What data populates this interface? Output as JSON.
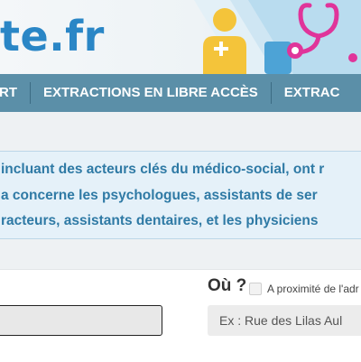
{
  "header": {
    "logo_text": "te.fr"
  },
  "nav": {
    "items": [
      {
        "label": "RT"
      },
      {
        "label": "EXTRACTIONS EN LIBRE ACCÈS"
      },
      {
        "label": "EXTRAC"
      }
    ]
  },
  "info": {
    "lines": [
      "incluant des acteurs clés du médico-social, ont r",
      "a concerne les psychologues, assistants de ser",
      "racteurs, assistants dentaires, et les physiciens"
    ]
  },
  "search": {
    "where_label": "Où ?",
    "proximity_label": "A proximité de l'adr",
    "where_placeholder": "Ex : Rue des Lilas Aul"
  },
  "colors": {
    "nav_bg": "#5b8fa8",
    "logo": "#2a86c6",
    "info_text": "#2f7aa5",
    "info_bg": "#e5f1f9"
  }
}
